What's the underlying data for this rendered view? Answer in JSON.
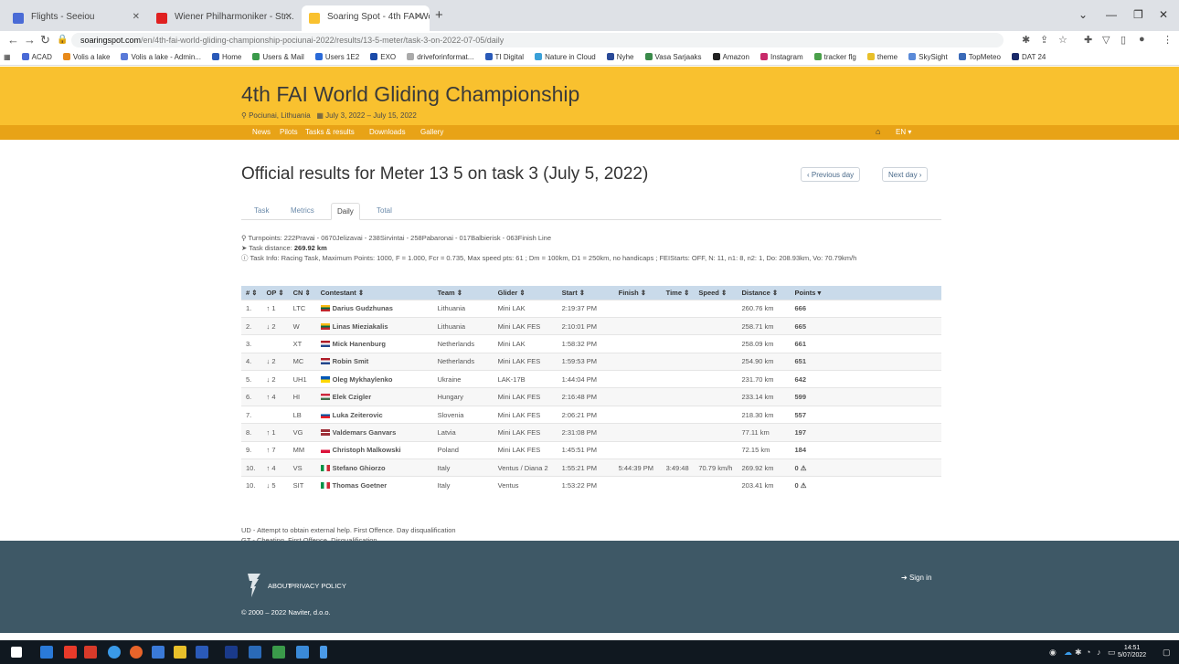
{
  "browser": {
    "tabs": [
      {
        "title": "Flights - Seeiou",
        "icon_color": "#4a6bd6"
      },
      {
        "title": "Wiener Philharmoniker - Str...",
        "icon_color": "#e02020"
      },
      {
        "title": "Soaring Spot - 4th FAI World Gl...",
        "icon_color": "#f9c12f"
      }
    ],
    "new_tab_icon": "plus-icon",
    "url_domain": "soaringspot.com",
    "url_path": "/en/4th-fai-world-gliding-championship-pociunai-2022/results/13-5-meter/task-3-on-2022-07-05/daily",
    "bookmarks": [
      "ACAD",
      "Volis a lake",
      "Volis a lake - Admin...",
      "Home",
      "Users & Mail",
      "Users 1E2",
      "EXO",
      "driveforinformat...",
      "TI Digital",
      "Nature in Cloud",
      "Nyhe",
      "Vasa Sarjaaks",
      "Amazon",
      "Instagram",
      "tracker flg",
      "theme",
      "SkySight",
      "TopMeteo",
      "DAT 24"
    ]
  },
  "site": {
    "title": "4th FAI World Gliding Championship",
    "location": "Pociunai, Lithuania",
    "dates": "July 3, 2022 – July 15, 2022",
    "nav": [
      "News",
      "Pilots",
      "Tasks & results",
      "Downloads",
      "Gallery"
    ],
    "lang": "EN"
  },
  "page": {
    "title": "Official results for Meter 13 5 on task 3 (July 5, 2022)",
    "prev_day": "Previous day",
    "next_day": "Next day",
    "subtabs": [
      "Task",
      "Metrics",
      "Daily",
      "Total"
    ],
    "active_subtab": "Daily",
    "turnpoints": "Turnpoints: 222Pravai - 0670Jelizavai - 238Sirvintai - 258Pabaronai - 017Balbierisk - 063Finish Line",
    "task_distance_label": "Task distance:",
    "task_distance": "269.92 km",
    "task_info": "Task Info: Racing Task, Maximum Points: 1000, F = 1.000, Fcr = 0.735, Max speed pts: 61 ; Dm = 100km, D1 = 250km, no handicaps ; FEIStarts: OFF, N: 11, n1: 8, n2: 1, Do: 208.93km, Vo: 70.79km/h"
  },
  "table": {
    "headers": [
      "# ⇕",
      "OP ⇕",
      "CN ⇕",
      "Contestant ⇕",
      "Team ⇕",
      "Glider ⇕",
      "Start ⇕",
      "Finish ⇕",
      "Time ⇕",
      "Speed ⇕",
      "Distance ⇕",
      "Points ▾"
    ],
    "rows": [
      {
        "rank": "1.",
        "op": "↑ 1",
        "cn": "LTC",
        "flag": "lt",
        "name": "Darius Gudzhunas",
        "team": "Lithuania",
        "glider": "Mini LAK",
        "start": "2:19:37 PM",
        "finish": "",
        "time": "",
        "speed": "",
        "distance": "260.76 km",
        "points": "666"
      },
      {
        "rank": "2.",
        "op": "↓ 2",
        "cn": "W",
        "flag": "lt",
        "name": "Linas Mieziakalis",
        "team": "Lithuania",
        "glider": "Mini LAK FES",
        "start": "2:10:01 PM",
        "finish": "",
        "time": "",
        "speed": "",
        "distance": "258.71 km",
        "points": "665"
      },
      {
        "rank": "3.",
        "op": "",
        "cn": "XT",
        "flag": "nl",
        "name": "Mick Hanenburg",
        "team": "Netherlands",
        "glider": "Mini LAK",
        "start": "1:58:32 PM",
        "finish": "",
        "time": "",
        "speed": "",
        "distance": "258.09 km",
        "points": "661"
      },
      {
        "rank": "4.",
        "op": "↓ 2",
        "cn": "MC",
        "flag": "nl",
        "name": "Robin Smit",
        "team": "Netherlands",
        "glider": "Mini LAK FES",
        "start": "1:59:53 PM",
        "finish": "",
        "time": "",
        "speed": "",
        "distance": "254.90 km",
        "points": "651"
      },
      {
        "rank": "5.",
        "op": "↓ 2",
        "cn": "UH1",
        "flag": "ua",
        "name": "Oleg Mykhaylenko",
        "team": "Ukraine",
        "glider": "LAK-17B",
        "start": "1:44:04 PM",
        "finish": "",
        "time": "",
        "speed": "",
        "distance": "231.70 km",
        "points": "642"
      },
      {
        "rank": "6.",
        "op": "↑ 4",
        "cn": "HI",
        "flag": "hu",
        "name": "Elek Czigler",
        "team": "Hungary",
        "glider": "Mini LAK FES",
        "start": "2:16:48 PM",
        "finish": "",
        "time": "",
        "speed": "",
        "distance": "233.14 km",
        "points": "599"
      },
      {
        "rank": "7.",
        "op": "",
        "cn": "LB",
        "flag": "si",
        "name": "Luka Zeiterovic",
        "team": "Slovenia",
        "glider": "Mini LAK FES",
        "start": "2:06:21 PM",
        "finish": "",
        "time": "",
        "speed": "",
        "distance": "218.30 km",
        "points": "557"
      },
      {
        "rank": "8.",
        "op": "↑ 1",
        "cn": "VG",
        "flag": "lv",
        "name": "Valdemars Ganvars",
        "team": "Latvia",
        "glider": "Mini LAK FES",
        "start": "2:31:08 PM",
        "finish": "",
        "time": "",
        "speed": "",
        "distance": "77.11 km",
        "points": "197"
      },
      {
        "rank": "9.",
        "op": "↑ 7",
        "cn": "MM",
        "flag": "pl",
        "name": "Christoph Malkowski",
        "team": "Poland",
        "glider": "Mini LAK FES",
        "start": "1:45:51 PM",
        "finish": "",
        "time": "",
        "speed": "",
        "distance": "72.15 km",
        "points": "184"
      },
      {
        "rank": "10.",
        "op": "↑ 4",
        "cn": "VS",
        "flag": "it",
        "name": "Stefano Ghiorzo",
        "team": "Italy",
        "glider": "Ventus / Diana 2",
        "start": "1:55:21 PM",
        "finish": "5:44:39 PM",
        "time": "3:49:48",
        "speed": "70.79 km/h",
        "distance": "269.92 km",
        "points": "0"
      },
      {
        "rank": "10.",
        "op": "↓ 5",
        "cn": "SIT",
        "flag": "it",
        "name": "Thomas Goetner",
        "team": "Italy",
        "glider": "Ventus",
        "start": "1:53:22 PM",
        "finish": "",
        "time": "",
        "speed": "",
        "distance": "203.41 km",
        "points": "0"
      }
    ]
  },
  "notes": [
    "UD - Attempt to obtain external help. First Offence. Day disqualification",
    "GT - Cheating. First Offence. Disqualification"
  ],
  "footer": {
    "about": "ABOUT",
    "privacy": "PRIVACY POLICY",
    "signin": "Sign in",
    "copyright": "© 2000 – 2022 Naviter, d.o.o."
  },
  "taskbar": {
    "time": "14:51",
    "date": "5/07/2022"
  },
  "colors": {
    "header": "#f9c12f",
    "nav": "#e8a317",
    "table_header": "#c9daea",
    "footer": "#3e5866"
  }
}
